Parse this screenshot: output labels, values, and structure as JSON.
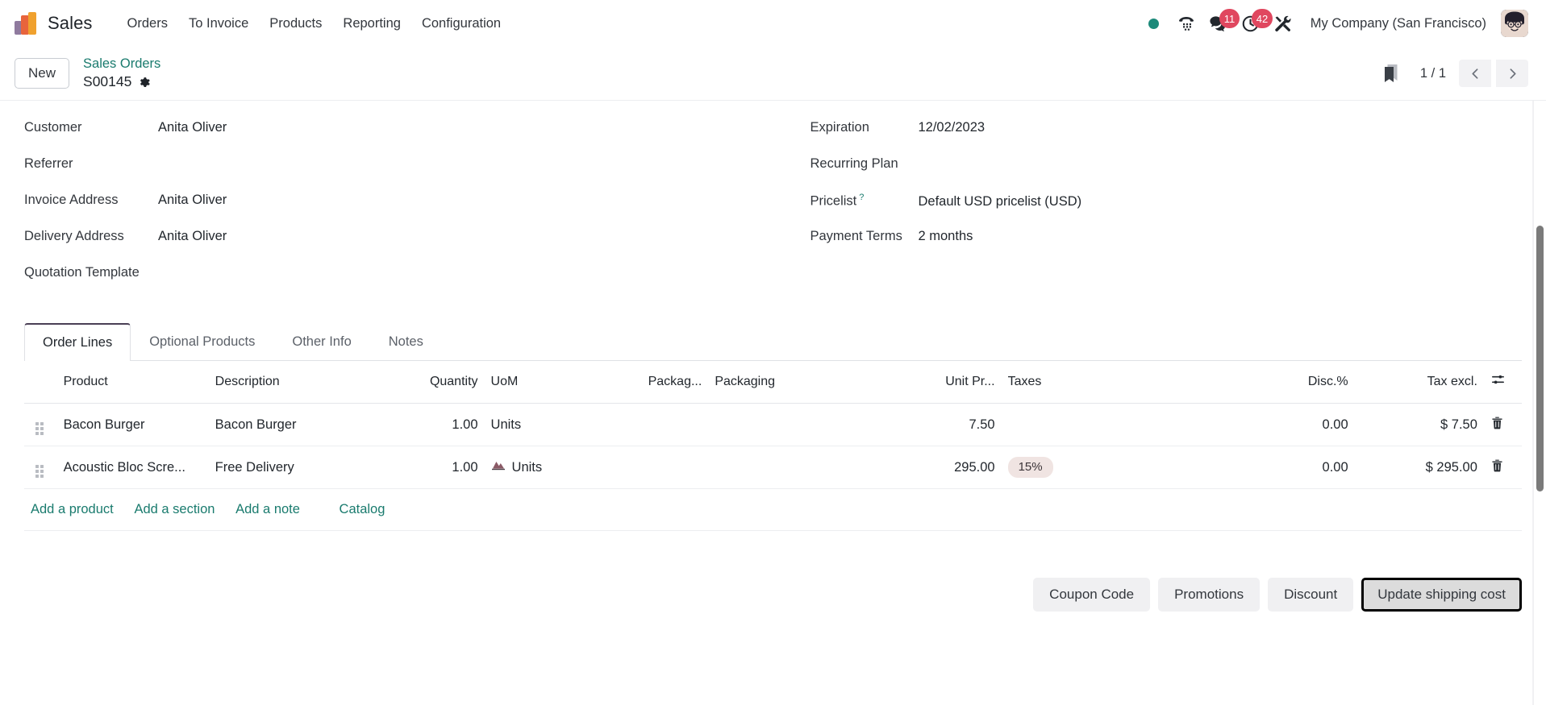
{
  "navbar": {
    "app_name": "Sales",
    "logo_icon": "sales-bars-logo",
    "menu_items": [
      {
        "label": "Orders"
      },
      {
        "label": "To Invoice"
      },
      {
        "label": "Products"
      },
      {
        "label": "Reporting"
      },
      {
        "label": "Configuration"
      }
    ],
    "systray": {
      "presence_icon": "green-status-dot",
      "phone_icon": "phone-dialpad-icon",
      "messages_icon": "chat-bubbles-icon",
      "messages_count": "11",
      "activities_icon": "clock-icon",
      "activities_count": "42",
      "debug_icon": "tools-icon"
    },
    "company": "My Company (San Francisco)",
    "avatar_icon": "user-avatar"
  },
  "control_panel": {
    "new_label": "New",
    "breadcrumb_parent": "Sales Orders",
    "record_name": "S00145",
    "settings_icon": "gear-icon",
    "bookmark_icon": "bookmark-icon",
    "pager": "1 / 1",
    "prev_icon": "chevron-left-icon",
    "next_icon": "chevron-right-icon"
  },
  "form": {
    "left_fields": [
      {
        "label": "Customer",
        "value": "Anita Oliver"
      },
      {
        "label": "Referrer",
        "value": ""
      },
      {
        "label": "Invoice Address",
        "value": "Anita Oliver"
      },
      {
        "label": "Delivery Address",
        "value": "Anita Oliver"
      },
      {
        "label": "Quotation Template",
        "value": ""
      }
    ],
    "right_fields": [
      {
        "label": "Expiration",
        "value": "12/02/2023",
        "help": ""
      },
      {
        "label": "Recurring Plan",
        "value": "",
        "help": ""
      },
      {
        "label": "Pricelist",
        "value": "Default USD pricelist (USD)",
        "help": "?"
      },
      {
        "label": "Payment Terms",
        "value": "2 months",
        "help": ""
      }
    ]
  },
  "notebook": {
    "tabs": [
      {
        "label": "Order Lines",
        "active": true
      },
      {
        "label": "Optional Products",
        "active": false
      },
      {
        "label": "Other Info",
        "active": false
      },
      {
        "label": "Notes",
        "active": false
      }
    ]
  },
  "order_lines": {
    "columns": [
      "Product",
      "Description",
      "Quantity",
      "UoM",
      "Packag...",
      "Packaging",
      "Unit Pr...",
      "Taxes",
      "Disc.%",
      "Tax excl."
    ],
    "optional_columns_icon": "sliders-settings-icon",
    "rows": [
      {
        "handle_icon": "drag-handle-icon",
        "product": "Bacon Burger",
        "description": "Bacon Burger",
        "quantity": "1.00",
        "uom": "Units",
        "uom_icon": "",
        "packaging_qty": "",
        "packaging": "",
        "unit_price": "7.50",
        "taxes": "",
        "discount": "0.00",
        "tax_excl": "$ 7.50",
        "delete_icon": "trash-icon"
      },
      {
        "handle_icon": "drag-handle-icon",
        "product": "Acoustic Bloc Scre...",
        "description": "Free Delivery",
        "quantity": "1.00",
        "uom": "Units",
        "uom_icon": "chart-mountain-icon",
        "packaging_qty": "",
        "packaging": "",
        "unit_price": "295.00",
        "taxes": "15%",
        "discount": "0.00",
        "tax_excl": "$ 295.00",
        "delete_icon": "trash-icon"
      }
    ],
    "add_links": [
      {
        "label": "Add a product"
      },
      {
        "label": "Add a section"
      },
      {
        "label": "Add a note"
      }
    ],
    "catalog_label": "Catalog"
  },
  "footer_buttons": [
    {
      "label": "Coupon Code",
      "focused": false
    },
    {
      "label": "Promotions",
      "focused": false
    },
    {
      "label": "Discount",
      "focused": false
    },
    {
      "label": "Update shipping cost",
      "focused": true
    }
  ],
  "colors": {
    "accent_teal": "#1a7b6e",
    "badge_red": "#e0475f",
    "presence_green": "#1d8a7a",
    "tax_pill_bg": "#f0e4e2"
  }
}
